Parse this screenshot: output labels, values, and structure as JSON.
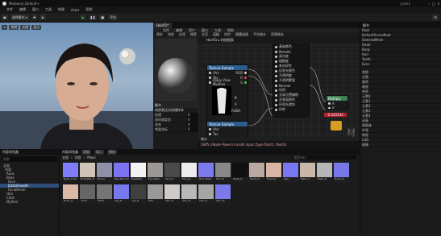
{
  "window": {
    "title": "Medieval_Default+",
    "user": "jcom1"
  },
  "menu": [
    "文件",
    "编辑",
    "窗口",
    "工具",
    "构建",
    "Actor",
    "帮助"
  ],
  "toolbar": {
    "mode_label": "选择模式",
    "play_label": "平台"
  },
  "viewport": {
    "buttons": [
      "透视",
      "光照",
      "显示"
    ]
  },
  "material_editor": {
    "tab": "Hair01*",
    "menu": [
      "文件",
      "编辑",
      "资产",
      "窗口",
      "工具",
      "帮助"
    ],
    "toolbar": [
      "保存",
      "浏览",
      "应用",
      "搜索",
      "主页",
      "层级",
      "实时",
      "隐藏连接",
      "平台统计",
      "资源统计"
    ],
    "graph_title": "Hair01 ▸ 材质图表",
    "watermark": "材质",
    "nodes": {
      "tex1": {
        "title": "Texture Sample",
        "pins": [
          "UVs",
          "Tex",
          "Apply View MipBias"
        ],
        "outs": [
          "RGB",
          "R",
          "G",
          "B",
          "A",
          "RGBA"
        ]
      },
      "tex2": {
        "title": "Texture Sample",
        "pins": [
          "UVs",
          "Tex"
        ]
      },
      "result_pins": [
        "基础颜色",
        "Metallic",
        "高光度",
        "粗糙度",
        "各向异性",
        "自发光颜色",
        "不透明度",
        "不透明蒙版",
        "Normal",
        "切线",
        "全局位置偏移",
        "次表面颜色",
        "环境光遮挡",
        "折射"
      ],
      "multiply": "Multiply",
      "multiply_pins": [
        "A",
        "B"
      ],
      "const_label": "0.333333"
    },
    "details": {
      "title": "细节",
      "section": "材质表达式纹理样本",
      "fields": [
        {
          "k": "纹理",
          "v": "0"
        },
        {
          "k": "采样器类型",
          "v": "0"
        },
        {
          "k": "混合",
          "v": "0"
        },
        {
          "k": "常量坐标",
          "v": "0"
        }
      ]
    },
    "log": {
      "tab": "统计",
      "text": "[SM5] (Node Power) Invalid input (type float1, float3)"
    }
  },
  "outliner": {
    "title": "内容浏览器",
    "search": "搜索",
    "tree": [
      "全部",
      "内容",
      "Aaas",
      "Base",
      "Face",
      "DataSmooth",
      "FacialAnim",
      "Hair",
      "Cloth",
      "MySkin"
    ]
  },
  "content_browser": {
    "tabs": [
      "内容浏览器",
      "添加",
      "导入",
      "保存"
    ],
    "path": [
      "全部",
      "内容",
      "Maps"
    ],
    "search": "搜索Hair",
    "assets": [
      {
        "label": "Base_Color",
        "color": "#7f7dfc"
      },
      {
        "label": "BodyMat_N",
        "color": "#cfc3b8"
      },
      {
        "label": "Brows",
        "color": "#8f8fa8"
      },
      {
        "label": "Eye_Normal",
        "color": "#7c73f2"
      },
      {
        "label": "EyeMask",
        "color": "#f3f3f3"
      },
      {
        "label": "Eye_Base",
        "color": "#9d9796"
      },
      {
        "label": "Face_D",
        "color": "#4a4a4a"
      },
      {
        "label": "Face_N",
        "color": "#ededed"
      },
      {
        "label": "Hair_Mask",
        "color": "#7d7aee"
      },
      {
        "label": "Hair_N",
        "color": "#888"
      },
      {
        "label": "Head_D",
        "color": "#101010"
      },
      {
        "label": "Head_N",
        "color": "#b8aaa0"
      },
      {
        "label": "Head_R",
        "color": "#d7b4a5"
      },
      {
        "label": "Lips",
        "color": "#7777f2"
      },
      {
        "label": "Mask_A",
        "color": "#c9b8a9"
      },
      {
        "label": "Mask_B",
        "color": "#b7b7b7"
      },
      {
        "label": "Body_N",
        "color": "#7777ea"
      },
      {
        "label": "Body_D",
        "color": "#dcb9a7"
      },
      {
        "label": "Cloth",
        "color": "#666"
      },
      {
        "label": "Teeth",
        "color": "#757575"
      },
      {
        "label": "Leg_N",
        "color": "#7878ee"
      },
      {
        "label": "Leg_D",
        "color": "#404040"
      },
      {
        "label": "Misc",
        "color": "#999"
      },
      {
        "label": "Skin_R",
        "color": "#cfc9c7"
      },
      {
        "label": "Skin_N",
        "color": "#b8b8b8"
      },
      {
        "label": "Skin_D",
        "color": "#a5a5a5"
      },
      {
        "label": "Skin_M",
        "color": "#7b78ec"
      }
    ]
  },
  "details_panel": {
    "title": "细节",
    "rows": [
      "Root",
      "DefaultSceneRoot",
      "SkeletalMesh",
      "Head",
      "Body",
      "Hair",
      "Teeth",
      "Eyes"
    ],
    "props": [
      "变换",
      "位置",
      "旋转",
      "缩放",
      "材质",
      "元素0",
      "元素1",
      "元素2",
      "元素3",
      "元素4",
      "动画",
      "网格体",
      "外观",
      "物理",
      "LOD",
      "碰撞"
    ]
  }
}
